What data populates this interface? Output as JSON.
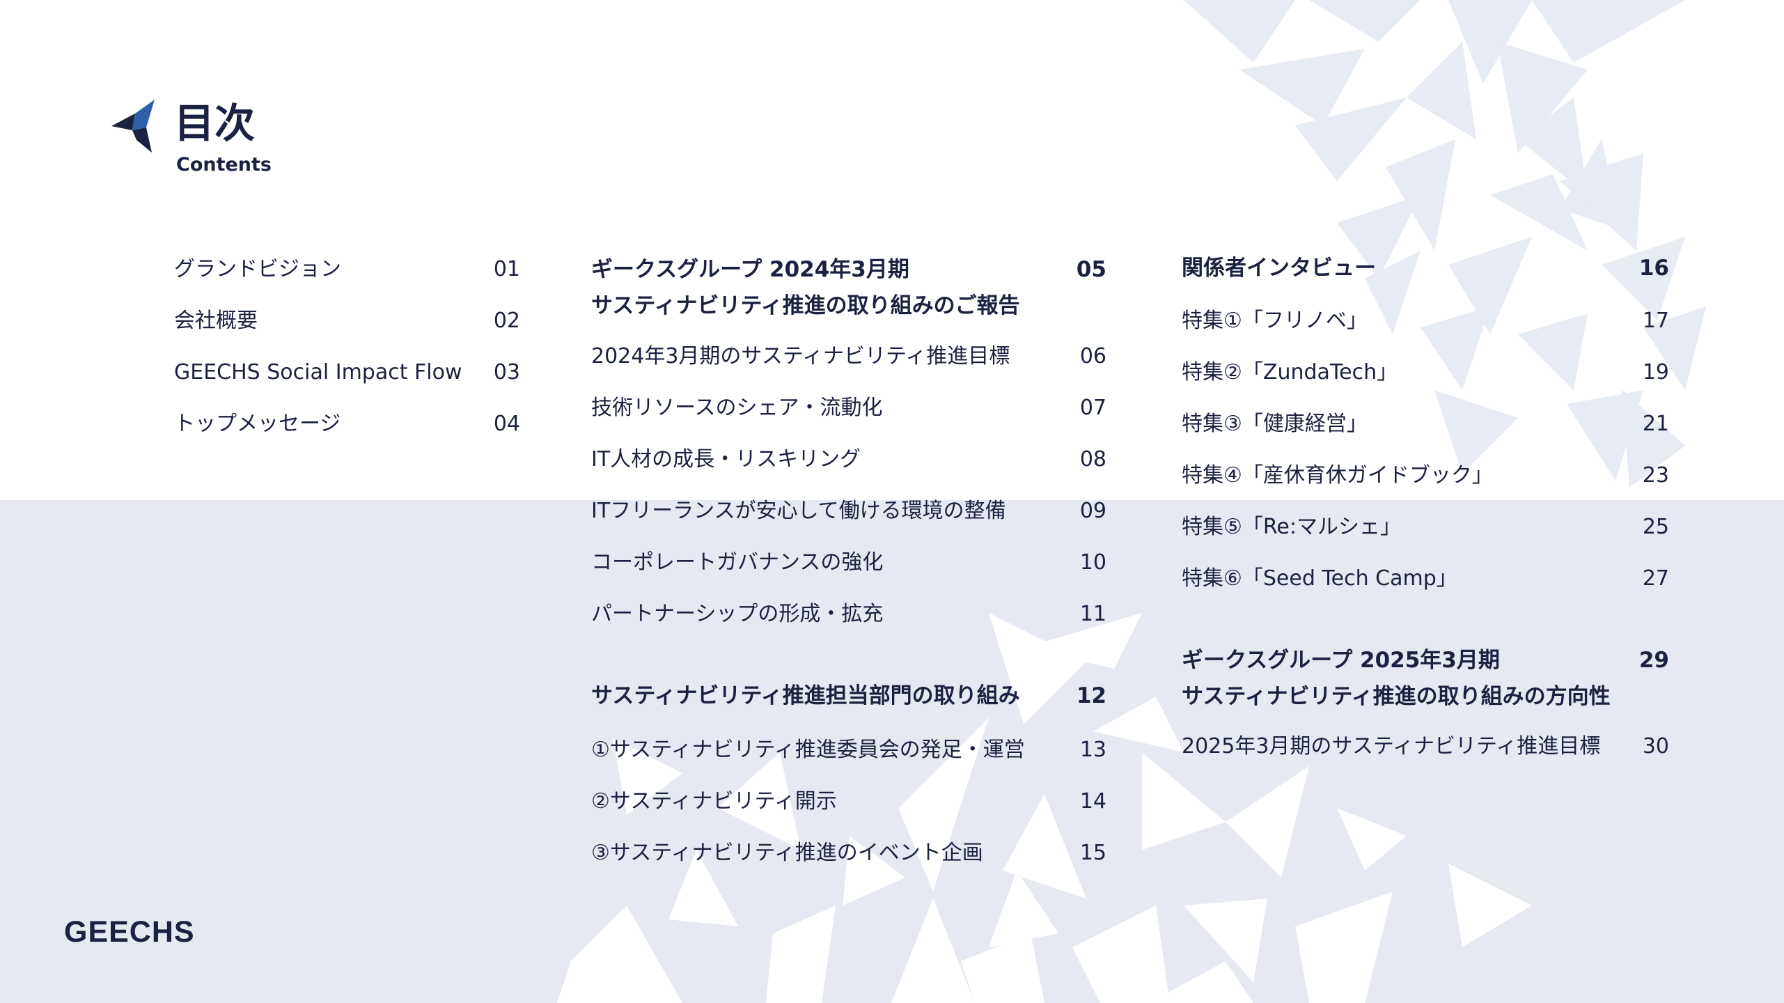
{
  "header": {
    "title": "目次",
    "subtitle": "Contents",
    "logo_icon": "geechs-star-icon"
  },
  "footer": {
    "brand": "GEECHS"
  },
  "colors": {
    "navy": "#1b2140",
    "brand_blue": "#2f5fa8",
    "lower_background": "#e6e9f1",
    "shard": "#ffffff"
  },
  "columns": [
    {
      "entries": [
        {
          "label": "グランドビジョン",
          "page": "01"
        },
        {
          "label": "会社概要",
          "page": "02"
        },
        {
          "label": "GEECHS Social Impact Flow",
          "page": "03"
        },
        {
          "label": "トップメッセージ",
          "page": "04"
        }
      ]
    },
    {
      "sections": [
        {
          "heading": [
            "ギークスグループ 2024年3月期",
            "サスティナビリティ推進の取り組みのご報告"
          ],
          "page": "05",
          "entries": [
            {
              "label": "2024年3月期のサスティナビリティ推進目標",
              "page": "06"
            },
            {
              "label": "技術リソースのシェア・流動化",
              "page": "07"
            },
            {
              "label": "IT人材の成長・リスキリング",
              "page": "08"
            },
            {
              "label": "ITフリーランスが安心して働ける環境の整備",
              "page": "09"
            },
            {
              "label": "コーポレートガバナンスの強化",
              "page": "10"
            },
            {
              "label": "パートナーシップの形成・拡充",
              "page": "11"
            }
          ]
        },
        {
          "heading": [
            "サスティナビリティ推進担当部門の取り組み"
          ],
          "page": "12",
          "entries": [
            {
              "label": "①サスティナビリティ推進委員会の発足・運営",
              "page": "13"
            },
            {
              "label": "②サスティナビリティ開示",
              "page": "14"
            },
            {
              "label": "③サスティナビリティ推進のイベント企画",
              "page": "15"
            }
          ]
        }
      ]
    },
    {
      "sections": [
        {
          "heading": [
            "関係者インタビュー"
          ],
          "page": "16",
          "entries": [
            {
              "label": "特集①「フリノベ」",
              "page": "17"
            },
            {
              "label": "特集②「ZundaTech」",
              "page": "19"
            },
            {
              "label": "特集③「健康経営」",
              "page": "21"
            },
            {
              "label": "特集④「産休育休ガイドブック」",
              "page": "23"
            },
            {
              "label": "特集⑤「Re:マルシェ」",
              "page": "25"
            },
            {
              "label": "特集⑥「Seed Tech Camp」",
              "page": "27"
            }
          ]
        },
        {
          "heading": [
            "ギークスグループ 2025年3月期",
            "サスティナビリティ推進の取り組みの方向性"
          ],
          "page": "29",
          "entries": [
            {
              "label": "2025年3月期のサスティナビリティ推進目標",
              "page": "30"
            }
          ]
        }
      ]
    }
  ]
}
